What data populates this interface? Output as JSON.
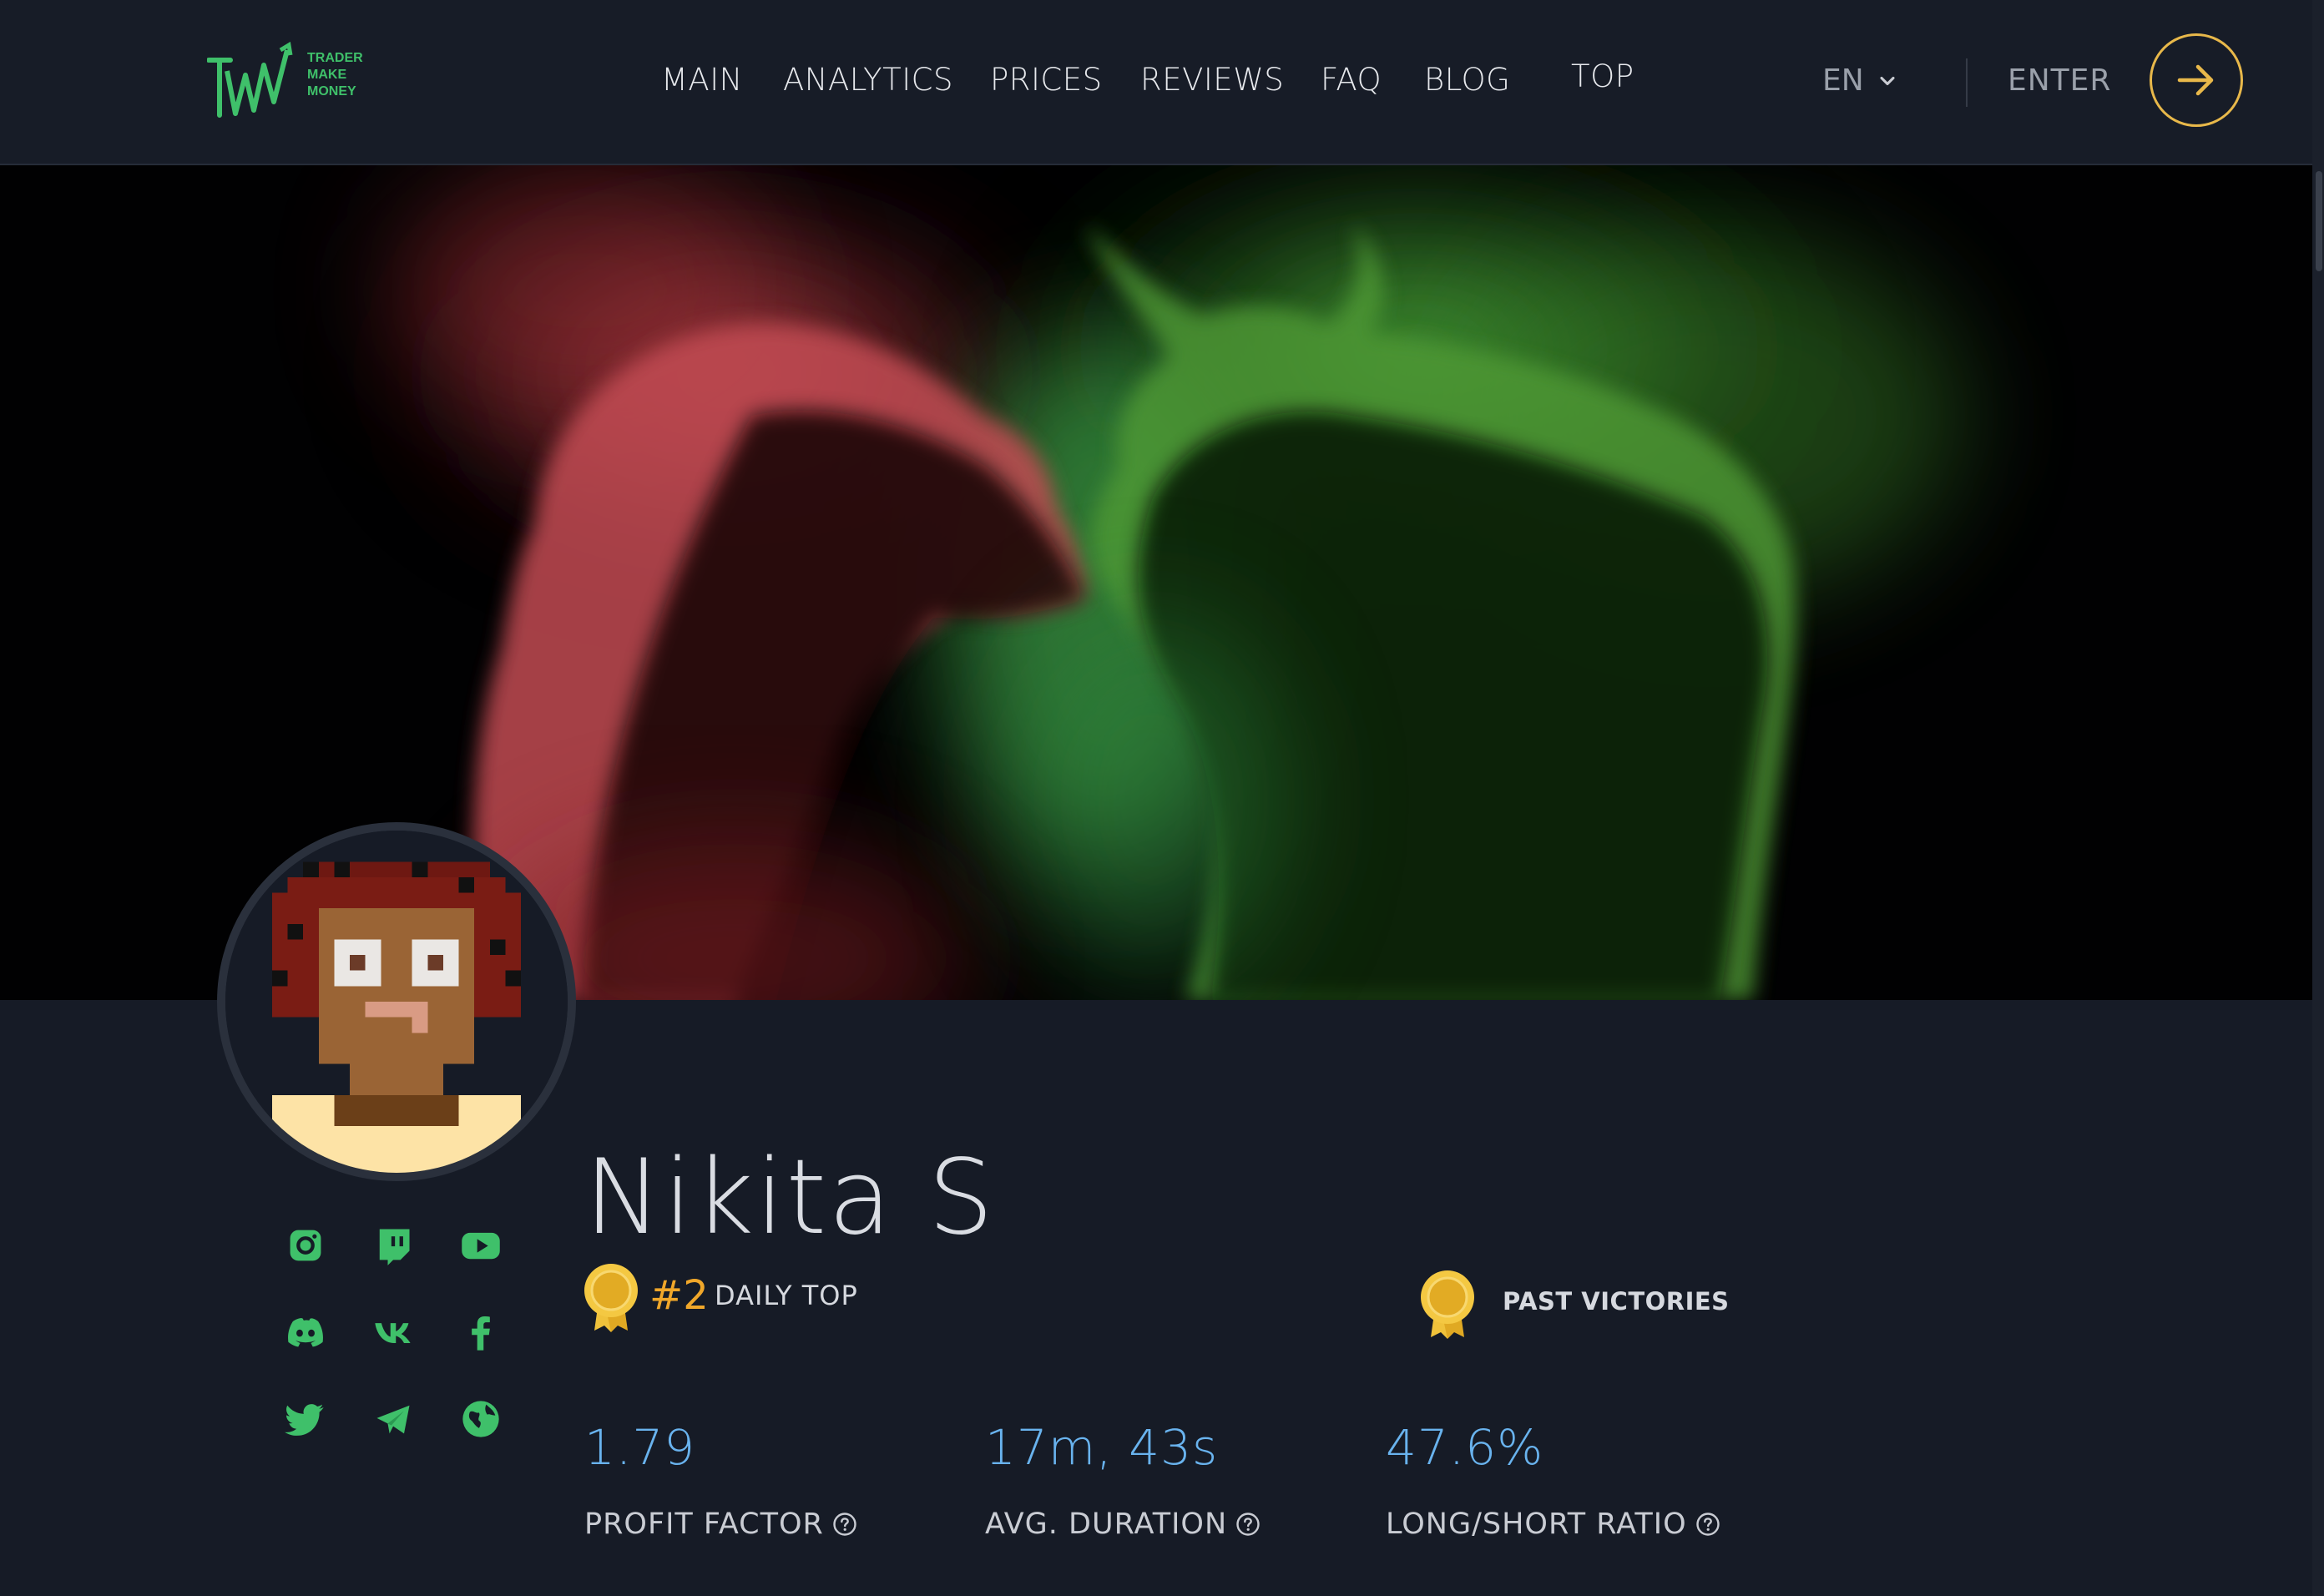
{
  "brand": {
    "logo_lines": [
      "TRADER",
      "MAKE",
      "MONEY"
    ]
  },
  "nav": {
    "items": [
      {
        "label": "MAIN"
      },
      {
        "label": "ANALYTICS"
      },
      {
        "label": "PRICES"
      },
      {
        "label": "REVIEWS"
      },
      {
        "label": "FAQ"
      },
      {
        "label": "BLOG"
      },
      {
        "label": "TOP"
      }
    ],
    "language": "EN",
    "enter_label": "ENTER"
  },
  "colors": {
    "accent_gold": "#e8b84a",
    "social_green": "#3fc06a",
    "stat_blue": "#69b3ee",
    "rank_orange": "#f0a72a"
  },
  "profile": {
    "name": "Nikita S",
    "socials": [
      "instagram-icon",
      "twitch-icon",
      "youtube-icon",
      "discord-icon",
      "vk-icon",
      "facebook-icon",
      "twitter-icon",
      "telegram-icon",
      "globe-icon"
    ],
    "rank": {
      "number": "#2",
      "label": "DAILY TOP"
    },
    "past_victories_label": "PAST VICTORIES",
    "stats": [
      {
        "value": "1.79",
        "label": "PROFIT FACTOR"
      },
      {
        "value": "17m, 43s",
        "label": "AVG. DURATION"
      },
      {
        "value": "47.6%",
        "label": "LONG/SHORT RATIO"
      }
    ]
  }
}
